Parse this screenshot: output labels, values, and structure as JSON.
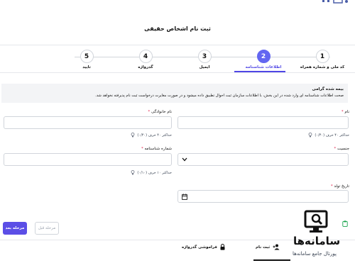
{
  "page": {
    "title": "ثبت نام اشخاص حقیقی"
  },
  "stepper": {
    "steps": [
      {
        "number": "1",
        "label": "کد ملی و شماره همراه"
      },
      {
        "number": "2",
        "label": "اطلاعات شناسنامه"
      },
      {
        "number": "3",
        "label": "ایمیل"
      },
      {
        "number": "4",
        "label": "گذرواژه"
      },
      {
        "number": "5",
        "label": "تایید"
      }
    ],
    "active_step": 2
  },
  "notice": {
    "heading": "بیمه شده گرامی",
    "body": "صحت اطلاعات شناسنامه ای وارد شده در این بخش، با اطلاعات سازمان ثبت احوال تطبیق داده میشود و در صورت مغایرت درخواست ثبت نام پذیرفته نخواهد شد."
  },
  "form": {
    "first_name": {
      "label": "نام",
      "value": "",
      "hint": "حداکثر ۴۰ حرف (۰/۴۰)"
    },
    "last_name": {
      "label": "نام خانوادگی",
      "value": "",
      "hint": "حداکثر ۴۰ حرف (۰/۴۰)"
    },
    "gender": {
      "label": "جنسیت",
      "value": ""
    },
    "id_number": {
      "label": "شماره شناسنامه",
      "value": "",
      "hint": "حداکثر ۱۰ حرف (۰/۱۰)"
    },
    "birth_date": {
      "label": "تاریخ تولد",
      "value": ""
    }
  },
  "buttons": {
    "next": "مرحله بعد",
    "prev": "مرحله قبل"
  },
  "bottom_tabs": [
    {
      "label": "ثبت نام",
      "icon": "user-add-icon",
      "active": true
    },
    {
      "label": "فراموشی گذرواژه",
      "icon": "lock-icon",
      "active": false
    }
  ],
  "watermark": {
    "name": "سامانه‌ها",
    "subtitle": "پورتال جامع سامانه‌ها"
  },
  "colors": {
    "accent": "#5b4ee6",
    "required": "#e11d48",
    "notice_bg": "#f3f4f6"
  }
}
